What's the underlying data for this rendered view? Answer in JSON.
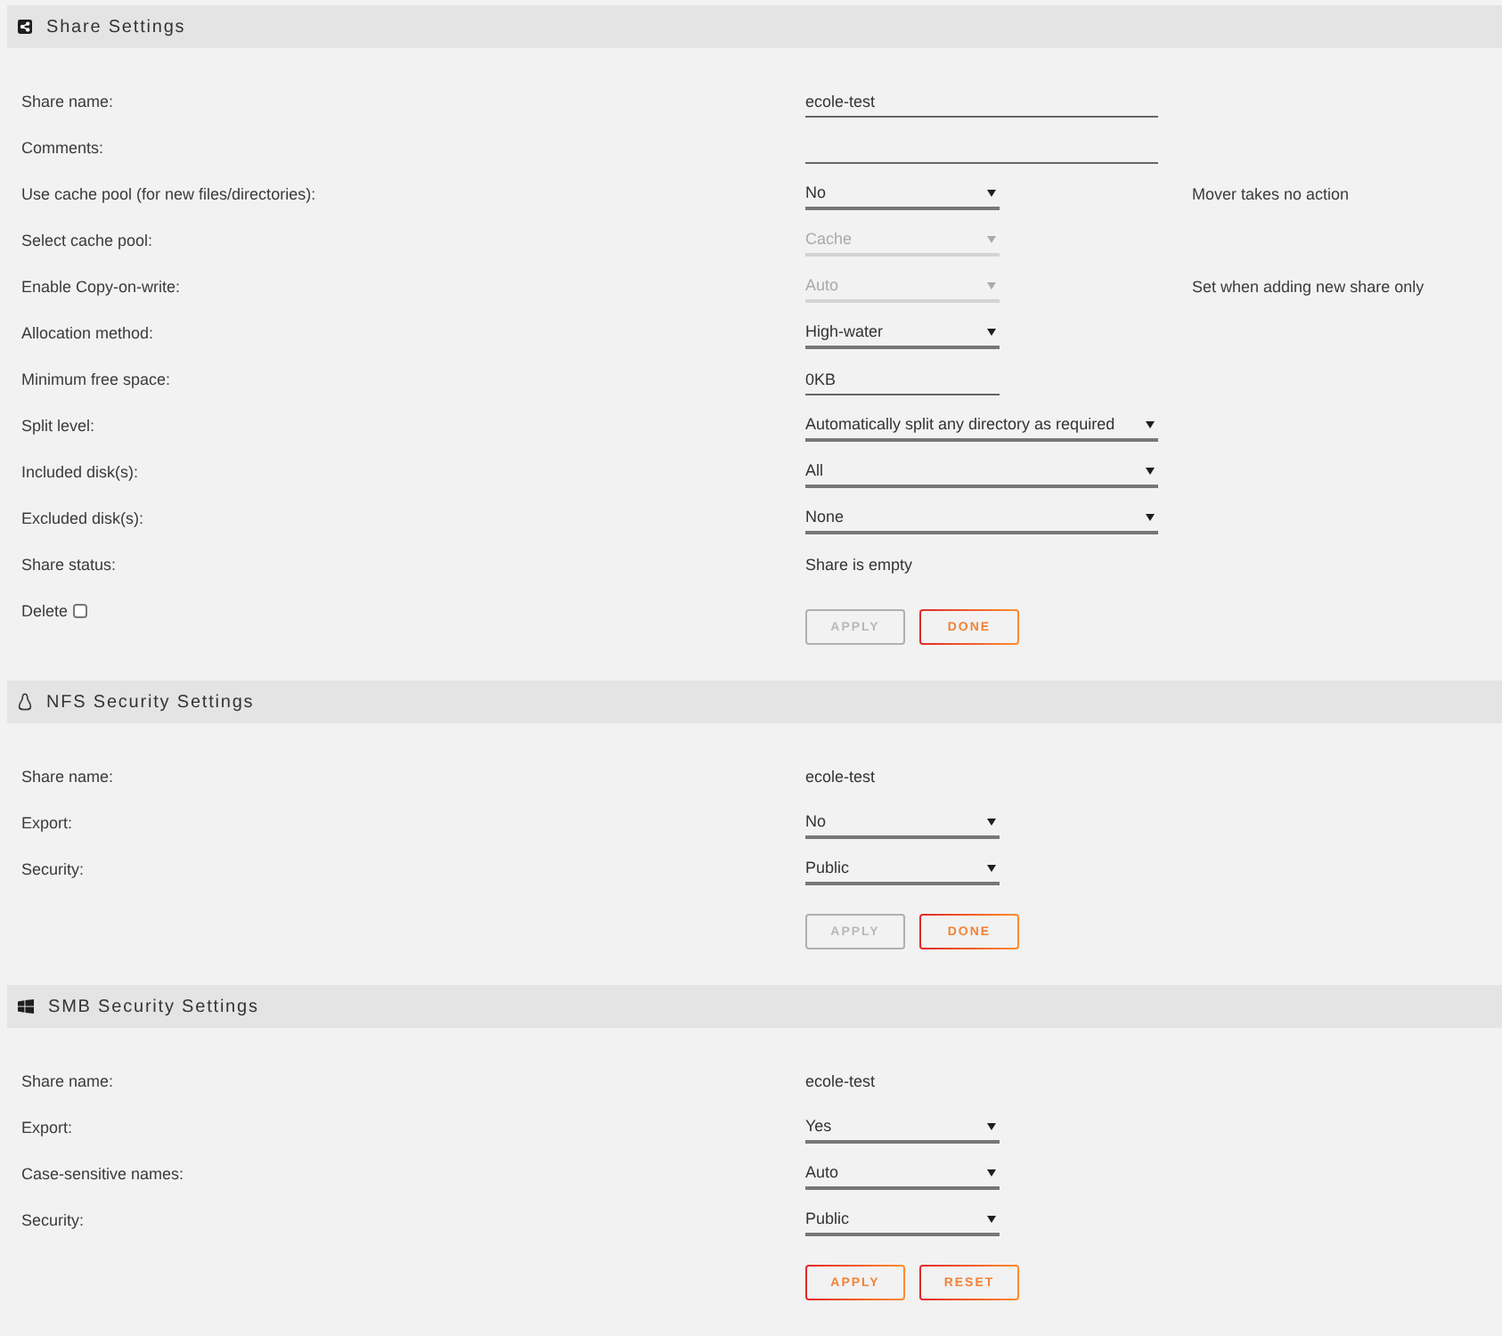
{
  "sections": [
    {
      "title": "Share Settings",
      "rows": [
        {
          "label": "Share name:",
          "kind": "input",
          "value": "ecole-test",
          "wide": true
        },
        {
          "label": "Comments:",
          "kind": "input",
          "wide": true
        },
        {
          "label": "Use cache pool (for new files/directories):",
          "kind": "select",
          "value": "No",
          "wide": false,
          "disabled": false,
          "note": "Mover takes no action"
        },
        {
          "label": "Select cache pool:",
          "kind": "select",
          "value": "Cache",
          "wide": false,
          "disabled": true
        },
        {
          "label": "Enable Copy-on-write:",
          "kind": "select",
          "value": "Auto",
          "wide": false,
          "disabled": true,
          "note": "Set when adding new share only"
        },
        {
          "label": "Allocation method:",
          "kind": "select",
          "value": "High-water",
          "wide": false,
          "disabled": false
        },
        {
          "label": "Minimum free space:",
          "kind": "input",
          "value": "0KB",
          "wide": false
        },
        {
          "label": "Split level:",
          "kind": "select",
          "value": "Automatically split any directory as required",
          "wide": true,
          "disabled": false
        },
        {
          "label": "Included disk(s):",
          "kind": "select",
          "value": "All",
          "wide": true,
          "disabled": false
        },
        {
          "label": "Excluded disk(s):",
          "kind": "select",
          "value": "None",
          "wide": true,
          "disabled": false
        },
        {
          "label": "Share status:",
          "kind": "text",
          "value": "Share is empty"
        }
      ],
      "delete": {
        "label": "Delete",
        "checked": false
      },
      "buttons": [
        {
          "label": "APPLY",
          "disabled": true
        },
        {
          "label": "DONE",
          "disabled": false
        }
      ]
    },
    {
      "title": "NFS Security Settings",
      "rows": [
        {
          "label": "Share name:",
          "kind": "text",
          "value": "ecole-test"
        },
        {
          "label": "Export:",
          "kind": "select",
          "value": "No",
          "wide": false,
          "disabled": false
        },
        {
          "label": "Security:",
          "kind": "select",
          "value": "Public",
          "wide": false,
          "disabled": false
        }
      ],
      "buttons": [
        {
          "label": "APPLY",
          "disabled": true
        },
        {
          "label": "DONE",
          "disabled": false
        }
      ]
    },
    {
      "title": "SMB Security Settings",
      "rows": [
        {
          "label": "Share name:",
          "kind": "text",
          "value": "ecole-test"
        },
        {
          "label": "Export:",
          "kind": "select",
          "value": "Yes",
          "wide": false,
          "disabled": false
        },
        {
          "label": "Case-sensitive names:",
          "kind": "select",
          "value": "Auto",
          "wide": false,
          "disabled": false
        },
        {
          "label": "Security:",
          "kind": "select",
          "value": "Public",
          "wide": false,
          "disabled": false
        }
      ],
      "buttons": [
        {
          "label": "APPLY",
          "disabled": false
        },
        {
          "label": "RESET",
          "disabled": false
        }
      ]
    }
  ]
}
